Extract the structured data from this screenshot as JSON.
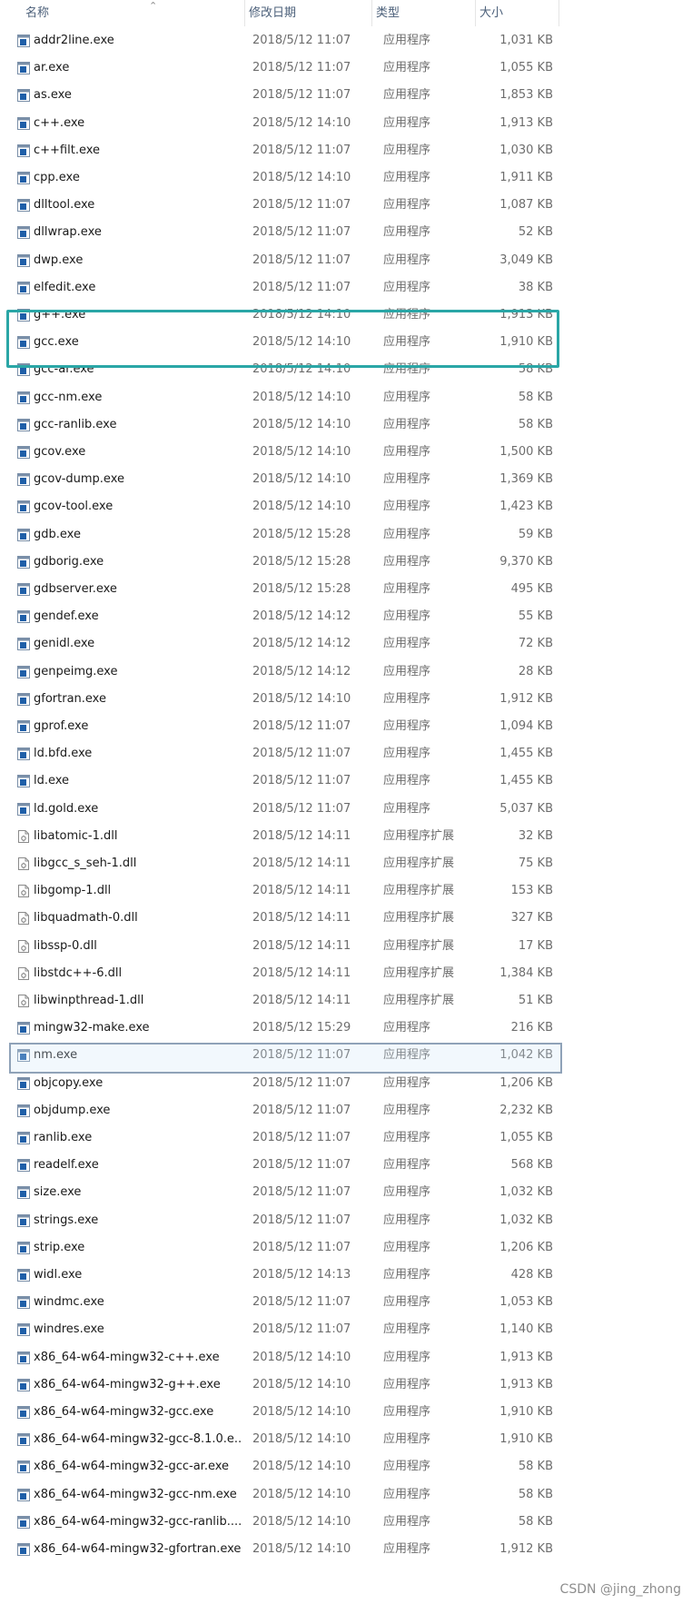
{
  "columns": {
    "name": "名称",
    "date": "修改日期",
    "type": "类型",
    "size": "大小"
  },
  "files": [
    {
      "name": "addr2line.exe",
      "date": "2018/5/12 11:07",
      "type": "应用程序",
      "size": "1,031 KB",
      "icon": "exe-icon"
    },
    {
      "name": "ar.exe",
      "date": "2018/5/12 11:07",
      "type": "应用程序",
      "size": "1,055 KB",
      "icon": "exe-icon"
    },
    {
      "name": "as.exe",
      "date": "2018/5/12 11:07",
      "type": "应用程序",
      "size": "1,853 KB",
      "icon": "exe-icon"
    },
    {
      "name": "c++.exe",
      "date": "2018/5/12 14:10",
      "type": "应用程序",
      "size": "1,913 KB",
      "icon": "exe-icon"
    },
    {
      "name": "c++filt.exe",
      "date": "2018/5/12 11:07",
      "type": "应用程序",
      "size": "1,030 KB",
      "icon": "exe-icon"
    },
    {
      "name": "cpp.exe",
      "date": "2018/5/12 14:10",
      "type": "应用程序",
      "size": "1,911 KB",
      "icon": "exe-icon"
    },
    {
      "name": "dlltool.exe",
      "date": "2018/5/12 11:07",
      "type": "应用程序",
      "size": "1,087 KB",
      "icon": "exe-icon"
    },
    {
      "name": "dllwrap.exe",
      "date": "2018/5/12 11:07",
      "type": "应用程序",
      "size": "52 KB",
      "icon": "exe-icon"
    },
    {
      "name": "dwp.exe",
      "date": "2018/5/12 11:07",
      "type": "应用程序",
      "size": "3,049 KB",
      "icon": "exe-icon"
    },
    {
      "name": "elfedit.exe",
      "date": "2018/5/12 11:07",
      "type": "应用程序",
      "size": "38 KB",
      "icon": "exe-icon"
    },
    {
      "name": "g++.exe",
      "date": "2018/5/12 14:10",
      "type": "应用程序",
      "size": "1,913 KB",
      "icon": "exe-icon"
    },
    {
      "name": "gcc.exe",
      "date": "2018/5/12 14:10",
      "type": "应用程序",
      "size": "1,910 KB",
      "icon": "exe-icon"
    },
    {
      "name": "gcc-ar.exe",
      "date": "2018/5/12 14:10",
      "type": "应用程序",
      "size": "58 KB",
      "icon": "exe-icon"
    },
    {
      "name": "gcc-nm.exe",
      "date": "2018/5/12 14:10",
      "type": "应用程序",
      "size": "58 KB",
      "icon": "exe-icon"
    },
    {
      "name": "gcc-ranlib.exe",
      "date": "2018/5/12 14:10",
      "type": "应用程序",
      "size": "58 KB",
      "icon": "exe-icon"
    },
    {
      "name": "gcov.exe",
      "date": "2018/5/12 14:10",
      "type": "应用程序",
      "size": "1,500 KB",
      "icon": "exe-icon"
    },
    {
      "name": "gcov-dump.exe",
      "date": "2018/5/12 14:10",
      "type": "应用程序",
      "size": "1,369 KB",
      "icon": "exe-icon"
    },
    {
      "name": "gcov-tool.exe",
      "date": "2018/5/12 14:10",
      "type": "应用程序",
      "size": "1,423 KB",
      "icon": "exe-icon"
    },
    {
      "name": "gdb.exe",
      "date": "2018/5/12 15:28",
      "type": "应用程序",
      "size": "59 KB",
      "icon": "exe-icon"
    },
    {
      "name": "gdborig.exe",
      "date": "2018/5/12 15:28",
      "type": "应用程序",
      "size": "9,370 KB",
      "icon": "exe-icon"
    },
    {
      "name": "gdbserver.exe",
      "date": "2018/5/12 15:28",
      "type": "应用程序",
      "size": "495 KB",
      "icon": "exe-icon"
    },
    {
      "name": "gendef.exe",
      "date": "2018/5/12 14:12",
      "type": "应用程序",
      "size": "55 KB",
      "icon": "exe-icon"
    },
    {
      "name": "genidl.exe",
      "date": "2018/5/12 14:12",
      "type": "应用程序",
      "size": "72 KB",
      "icon": "exe-icon"
    },
    {
      "name": "genpeimg.exe",
      "date": "2018/5/12 14:12",
      "type": "应用程序",
      "size": "28 KB",
      "icon": "exe-icon"
    },
    {
      "name": "gfortran.exe",
      "date": "2018/5/12 14:10",
      "type": "应用程序",
      "size": "1,912 KB",
      "icon": "exe-icon"
    },
    {
      "name": "gprof.exe",
      "date": "2018/5/12 11:07",
      "type": "应用程序",
      "size": "1,094 KB",
      "icon": "exe-icon"
    },
    {
      "name": "ld.bfd.exe",
      "date": "2018/5/12 11:07",
      "type": "应用程序",
      "size": "1,455 KB",
      "icon": "exe-icon"
    },
    {
      "name": "ld.exe",
      "date": "2018/5/12 11:07",
      "type": "应用程序",
      "size": "1,455 KB",
      "icon": "exe-icon"
    },
    {
      "name": "ld.gold.exe",
      "date": "2018/5/12 11:07",
      "type": "应用程序",
      "size": "5,037 KB",
      "icon": "exe-icon"
    },
    {
      "name": "libatomic-1.dll",
      "date": "2018/5/12 14:11",
      "type": "应用程序扩展",
      "size": "32 KB",
      "icon": "dll-icon"
    },
    {
      "name": "libgcc_s_seh-1.dll",
      "date": "2018/5/12 14:11",
      "type": "应用程序扩展",
      "size": "75 KB",
      "icon": "dll-icon"
    },
    {
      "name": "libgomp-1.dll",
      "date": "2018/5/12 14:11",
      "type": "应用程序扩展",
      "size": "153 KB",
      "icon": "dll-icon"
    },
    {
      "name": "libquadmath-0.dll",
      "date": "2018/5/12 14:11",
      "type": "应用程序扩展",
      "size": "327 KB",
      "icon": "dll-icon"
    },
    {
      "name": "libssp-0.dll",
      "date": "2018/5/12 14:11",
      "type": "应用程序扩展",
      "size": "17 KB",
      "icon": "dll-icon"
    },
    {
      "name": "libstdc++-6.dll",
      "date": "2018/5/12 14:11",
      "type": "应用程序扩展",
      "size": "1,384 KB",
      "icon": "dll-icon"
    },
    {
      "name": "libwinpthread-1.dll",
      "date": "2018/5/12 14:11",
      "type": "应用程序扩展",
      "size": "51 KB",
      "icon": "dll-icon"
    },
    {
      "name": "mingw32-make.exe",
      "date": "2018/5/12 15:29",
      "type": "应用程序",
      "size": "216 KB",
      "icon": "exe-icon"
    },
    {
      "name": "nm.exe",
      "date": "2018/5/12 11:07",
      "type": "应用程序",
      "size": "1,042 KB",
      "icon": "exe-icon"
    },
    {
      "name": "objcopy.exe",
      "date": "2018/5/12 11:07",
      "type": "应用程序",
      "size": "1,206 KB",
      "icon": "exe-icon"
    },
    {
      "name": "objdump.exe",
      "date": "2018/5/12 11:07",
      "type": "应用程序",
      "size": "2,232 KB",
      "icon": "exe-icon"
    },
    {
      "name": "ranlib.exe",
      "date": "2018/5/12 11:07",
      "type": "应用程序",
      "size": "1,055 KB",
      "icon": "exe-icon"
    },
    {
      "name": "readelf.exe",
      "date": "2018/5/12 11:07",
      "type": "应用程序",
      "size": "568 KB",
      "icon": "exe-icon"
    },
    {
      "name": "size.exe",
      "date": "2018/5/12 11:07",
      "type": "应用程序",
      "size": "1,032 KB",
      "icon": "exe-icon"
    },
    {
      "name": "strings.exe",
      "date": "2018/5/12 11:07",
      "type": "应用程序",
      "size": "1,032 KB",
      "icon": "exe-icon"
    },
    {
      "name": "strip.exe",
      "date": "2018/5/12 11:07",
      "type": "应用程序",
      "size": "1,206 KB",
      "icon": "exe-icon"
    },
    {
      "name": "widl.exe",
      "date": "2018/5/12 14:13",
      "type": "应用程序",
      "size": "428 KB",
      "icon": "exe-icon"
    },
    {
      "name": "windmc.exe",
      "date": "2018/5/12 11:07",
      "type": "应用程序",
      "size": "1,053 KB",
      "icon": "exe-icon"
    },
    {
      "name": "windres.exe",
      "date": "2018/5/12 11:07",
      "type": "应用程序",
      "size": "1,140 KB",
      "icon": "exe-icon"
    },
    {
      "name": "x86_64-w64-mingw32-c++.exe",
      "date": "2018/5/12 14:10",
      "type": "应用程序",
      "size": "1,913 KB",
      "icon": "exe-icon"
    },
    {
      "name": "x86_64-w64-mingw32-g++.exe",
      "date": "2018/5/12 14:10",
      "type": "应用程序",
      "size": "1,913 KB",
      "icon": "exe-icon"
    },
    {
      "name": "x86_64-w64-mingw32-gcc.exe",
      "date": "2018/5/12 14:10",
      "type": "应用程序",
      "size": "1,910 KB",
      "icon": "exe-icon"
    },
    {
      "name": "x86_64-w64-mingw32-gcc-8.1.0.e...",
      "date": "2018/5/12 14:10",
      "type": "应用程序",
      "size": "1,910 KB",
      "icon": "exe-icon"
    },
    {
      "name": "x86_64-w64-mingw32-gcc-ar.exe",
      "date": "2018/5/12 14:10",
      "type": "应用程序",
      "size": "58 KB",
      "icon": "exe-icon"
    },
    {
      "name": "x86_64-w64-mingw32-gcc-nm.exe",
      "date": "2018/5/12 14:10",
      "type": "应用程序",
      "size": "58 KB",
      "icon": "exe-icon"
    },
    {
      "name": "x86_64-w64-mingw32-gcc-ranlib....",
      "date": "2018/5/12 14:10",
      "type": "应用程序",
      "size": "58 KB",
      "icon": "exe-icon"
    },
    {
      "name": "x86_64-w64-mingw32-gfortran.exe",
      "date": "2018/5/12 14:10",
      "type": "应用程序",
      "size": "1,912 KB",
      "icon": "exe-icon"
    }
  ],
  "watermark": "CSDN @jing_zhong",
  "colors": {
    "highlight_border": "#2aa6a6",
    "selection_border": "#8fa2b8",
    "exe_icon": "#1f5fa8"
  }
}
